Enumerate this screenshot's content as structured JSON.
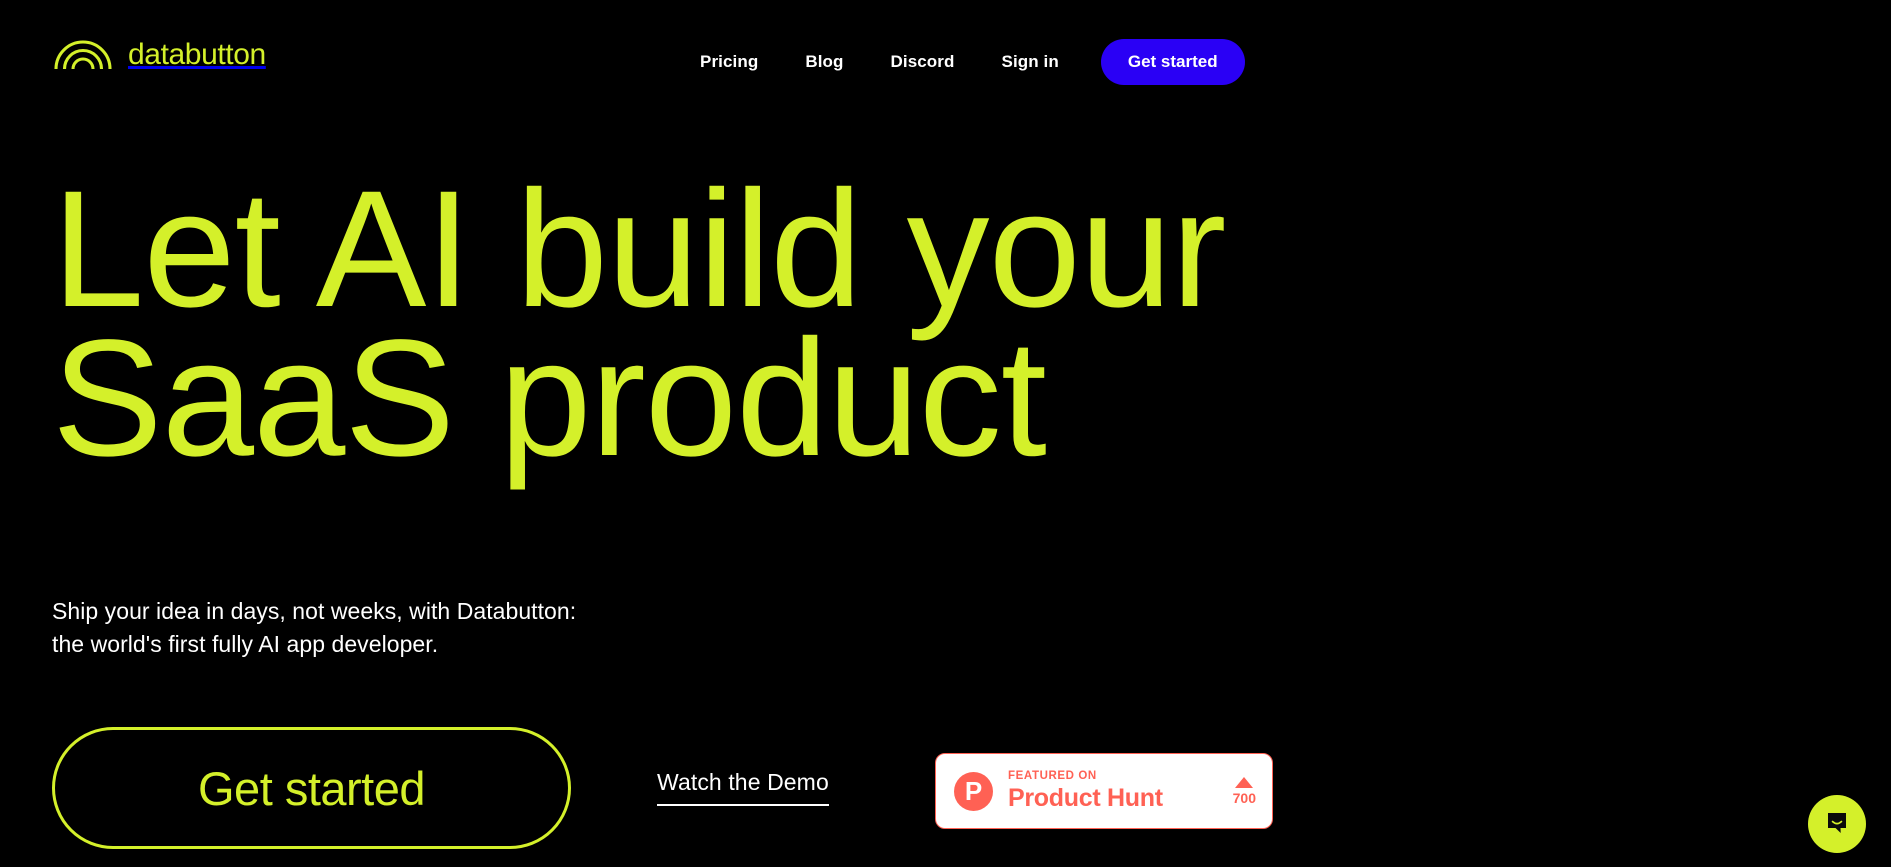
{
  "brand": {
    "name": "databutton",
    "logo_icon": "rainbow-arcs-icon",
    "color": "#d4f02a"
  },
  "nav": {
    "links": [
      {
        "label": "Pricing"
      },
      {
        "label": "Blog"
      },
      {
        "label": "Discord"
      },
      {
        "label": "Sign in"
      }
    ],
    "cta": {
      "label": "Get started",
      "background": "#2a00f5",
      "text_color": "#ffffff"
    }
  },
  "hero": {
    "headline": "Let AI build your\nSaaS product",
    "headline_color": "#d4f02a",
    "subhead": "Ship your idea in days, not weeks, with Databutton:\nthe world's first fully AI app developer.",
    "primary_cta": "Get started",
    "demo_link": "Watch the Demo"
  },
  "product_hunt": {
    "featured_label": "FEATURED ON",
    "name": "Product Hunt",
    "logo_letter": "P",
    "upvote_icon": "triangle-up-icon",
    "upvotes": "700",
    "accent_color": "#ff6154",
    "background": "#ffffff"
  },
  "chat": {
    "icon": "chat-bubble-smile-icon",
    "background": "#d4f02a"
  },
  "page": {
    "background": "#000000"
  }
}
